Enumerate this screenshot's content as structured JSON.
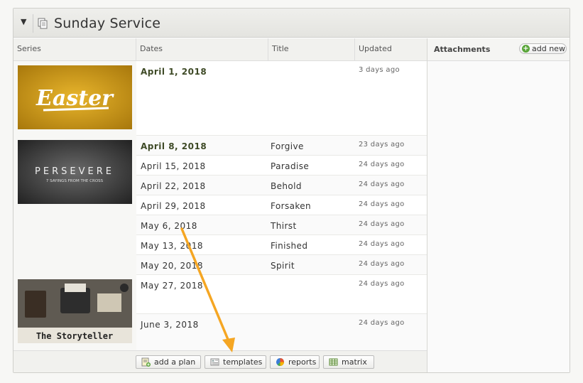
{
  "header": {
    "title": "Sunday Service"
  },
  "columns": {
    "series": "Series",
    "dates": "Dates",
    "title": "Title",
    "updated": "Updated"
  },
  "rows": [
    {
      "date": "April 1, 2018",
      "title": "",
      "updated": "3 days ago",
      "bold": true
    },
    {
      "date": "April 8, 2018",
      "title": "Forgive",
      "updated": "23 days ago",
      "bold": true
    },
    {
      "date": "April 15, 2018",
      "title": "Paradise",
      "updated": "24 days ago",
      "bold": false
    },
    {
      "date": "April 22, 2018",
      "title": "Behold",
      "updated": "24 days ago",
      "bold": false
    },
    {
      "date": "April 29, 2018",
      "title": "Forsaken",
      "updated": "24 days ago",
      "bold": false
    },
    {
      "date": "May 6, 2018",
      "title": "Thirst",
      "updated": "24 days ago",
      "bold": false
    },
    {
      "date": "May 13, 2018",
      "title": "Finished",
      "updated": "24 days ago",
      "bold": false
    },
    {
      "date": "May 20, 2018",
      "title": "Spirit",
      "updated": "24 days ago",
      "bold": false
    },
    {
      "date": "May 27, 2018",
      "title": "",
      "updated": "24 days ago",
      "bold": false
    },
    {
      "date": "June 3, 2018",
      "title": "",
      "updated": "24 days ago",
      "bold": false
    }
  ],
  "series_images": [
    {
      "label": "Easter",
      "bg": "#c8931a"
    },
    {
      "label": "PERSEVERE",
      "sublabel": "7 SAYINGS FROM THE CROSS",
      "bg": "#3b3b3b"
    },
    {
      "label": "The Storyteller",
      "bg": "#6b665e"
    }
  ],
  "footer": {
    "add_plan": "add a plan",
    "templates": "templates",
    "reports": "reports",
    "matrix": "matrix"
  },
  "attachments": {
    "title": "Attachments",
    "add_new": "add new"
  },
  "colors": {
    "accent_arrow": "#f5a623",
    "bold_date": "#3e4a26",
    "add_green": "#5aa63a"
  }
}
